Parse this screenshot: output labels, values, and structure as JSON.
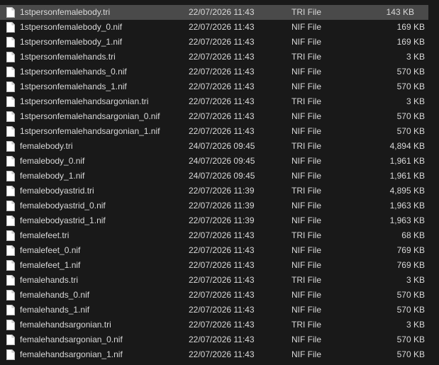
{
  "files": [
    {
      "name": "1stpersonfemalebody.tri",
      "date": "22/07/2026 11:43",
      "type": "TRI File",
      "size": "143 KB",
      "selected": true
    },
    {
      "name": "1stpersonfemalebody_0.nif",
      "date": "22/07/2026 11:43",
      "type": "NIF File",
      "size": "169 KB"
    },
    {
      "name": "1stpersonfemalebody_1.nif",
      "date": "22/07/2026 11:43",
      "type": "NIF File",
      "size": "169 KB"
    },
    {
      "name": "1stpersonfemalehands.tri",
      "date": "22/07/2026 11:43",
      "type": "TRI File",
      "size": "3 KB"
    },
    {
      "name": "1stpersonfemalehands_0.nif",
      "date": "22/07/2026 11:43",
      "type": "NIF File",
      "size": "570 KB"
    },
    {
      "name": "1stpersonfemalehands_1.nif",
      "date": "22/07/2026 11:43",
      "type": "NIF File",
      "size": "570 KB"
    },
    {
      "name": "1stpersonfemalehandsargonian.tri",
      "date": "22/07/2026 11:43",
      "type": "TRI File",
      "size": "3 KB"
    },
    {
      "name": "1stpersonfemalehandsargonian_0.nif",
      "date": "22/07/2026 11:43",
      "type": "NIF File",
      "size": "570 KB"
    },
    {
      "name": "1stpersonfemalehandsargonian_1.nif",
      "date": "22/07/2026 11:43",
      "type": "NIF File",
      "size": "570 KB"
    },
    {
      "name": "femalebody.tri",
      "date": "24/07/2026 09:45",
      "type": "TRI File",
      "size": "4,894 KB"
    },
    {
      "name": "femalebody_0.nif",
      "date": "24/07/2026 09:45",
      "type": "NIF File",
      "size": "1,961 KB"
    },
    {
      "name": "femalebody_1.nif",
      "date": "24/07/2026 09:45",
      "type": "NIF File",
      "size": "1,961 KB"
    },
    {
      "name": "femalebodyastrid.tri",
      "date": "22/07/2026 11:39",
      "type": "TRI File",
      "size": "4,895 KB"
    },
    {
      "name": "femalebodyastrid_0.nif",
      "date": "22/07/2026 11:39",
      "type": "NIF File",
      "size": "1,963 KB"
    },
    {
      "name": "femalebodyastrid_1.nif",
      "date": "22/07/2026 11:39",
      "type": "NIF File",
      "size": "1,963 KB"
    },
    {
      "name": "femalefeet.tri",
      "date": "22/07/2026 11:43",
      "type": "TRI File",
      "size": "68 KB"
    },
    {
      "name": "femalefeet_0.nif",
      "date": "22/07/2026 11:43",
      "type": "NIF File",
      "size": "769 KB"
    },
    {
      "name": "femalefeet_1.nif",
      "date": "22/07/2026 11:43",
      "type": "NIF File",
      "size": "769 KB"
    },
    {
      "name": "femalehands.tri",
      "date": "22/07/2026 11:43",
      "type": "TRI File",
      "size": "3 KB"
    },
    {
      "name": "femalehands_0.nif",
      "date": "22/07/2026 11:43",
      "type": "NIF File",
      "size": "570 KB"
    },
    {
      "name": "femalehands_1.nif",
      "date": "22/07/2026 11:43",
      "type": "NIF File",
      "size": "570 KB"
    },
    {
      "name": "femalehandsargonian.tri",
      "date": "22/07/2026 11:43",
      "type": "TRI File",
      "size": "3 KB"
    },
    {
      "name": "femalehandsargonian_0.nif",
      "date": "22/07/2026 11:43",
      "type": "NIF File",
      "size": "570 KB"
    },
    {
      "name": "femalehandsargonian_1.nif",
      "date": "22/07/2026 11:43",
      "type": "NIF File",
      "size": "570 KB"
    }
  ],
  "icons": {
    "file": "file-icon"
  },
  "colors": {
    "background": "#191919",
    "selected_row": "#4a4a4a",
    "text": "#d9d9d9"
  }
}
